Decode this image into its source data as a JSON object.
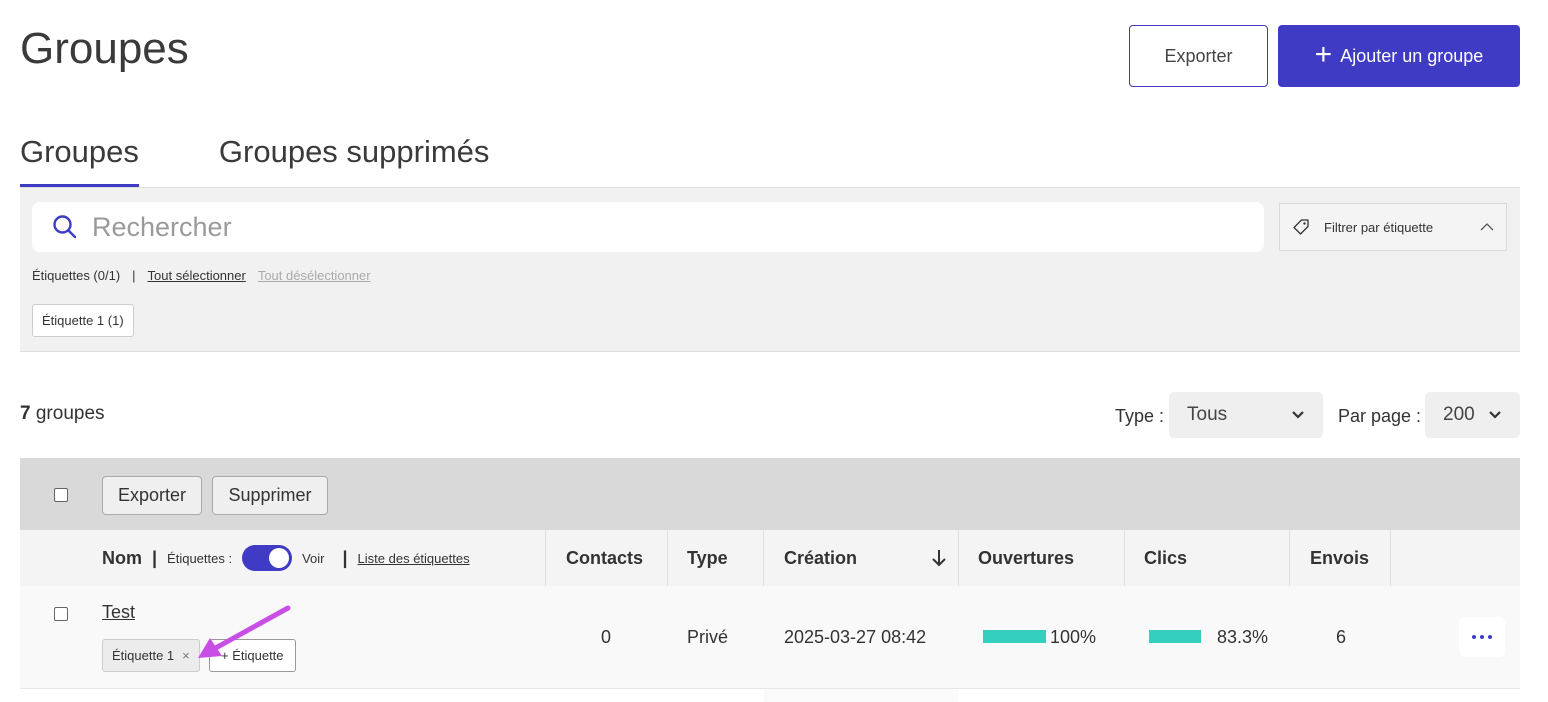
{
  "header": {
    "title": "Groupes",
    "export_label": "Exporter",
    "add_label": "Ajouter un groupe"
  },
  "tabs": [
    {
      "label": "Groupes",
      "active": true
    },
    {
      "label": "Groupes supprimés",
      "active": false
    }
  ],
  "filters": {
    "search_placeholder": "Rechercher",
    "tag_filter_label": "Filtrer par étiquette",
    "labels_count": "Étiquettes (0/1)",
    "separator": "|",
    "select_all": "Tout sélectionner",
    "deselect_all": "Tout désélectionner",
    "tag_chip": "Étiquette 1 (1)"
  },
  "list_controls": {
    "count_number": "7",
    "count_text": "groupes",
    "type_label": "Type :",
    "type_value": "Tous",
    "per_page_label": "Par page :",
    "per_page_value": "200"
  },
  "bulk": {
    "export_label": "Exporter",
    "delete_label": "Supprimer"
  },
  "table": {
    "columns": {
      "nom": "Nom",
      "nom_sep": "|",
      "etiquettes": "Étiquettes :",
      "voir": "Voir",
      "sep2": "|",
      "liste": "Liste des étiquettes",
      "contacts": "Contacts",
      "type": "Type",
      "creation": "Création",
      "ouvertures": "Ouvertures",
      "clics": "Clics",
      "envois": "Envois"
    },
    "show_tags_toggle": true,
    "rows": [
      {
        "name": "Test",
        "tag": "Étiquette 1",
        "tag_remove": "×",
        "add_tag": "+ Étiquette",
        "contacts": "0",
        "type": "Privé",
        "creation": "2025-03-27 08:42",
        "ouvertures": "100%",
        "ouvertures_fraction": 1.0,
        "clics": "83.3%",
        "clics_fraction": 0.833,
        "envois": "6"
      }
    ]
  },
  "colors": {
    "accent": "#3f3bc4",
    "bar": "#35cfbd",
    "annotation_arrow": "#c94ee6"
  }
}
